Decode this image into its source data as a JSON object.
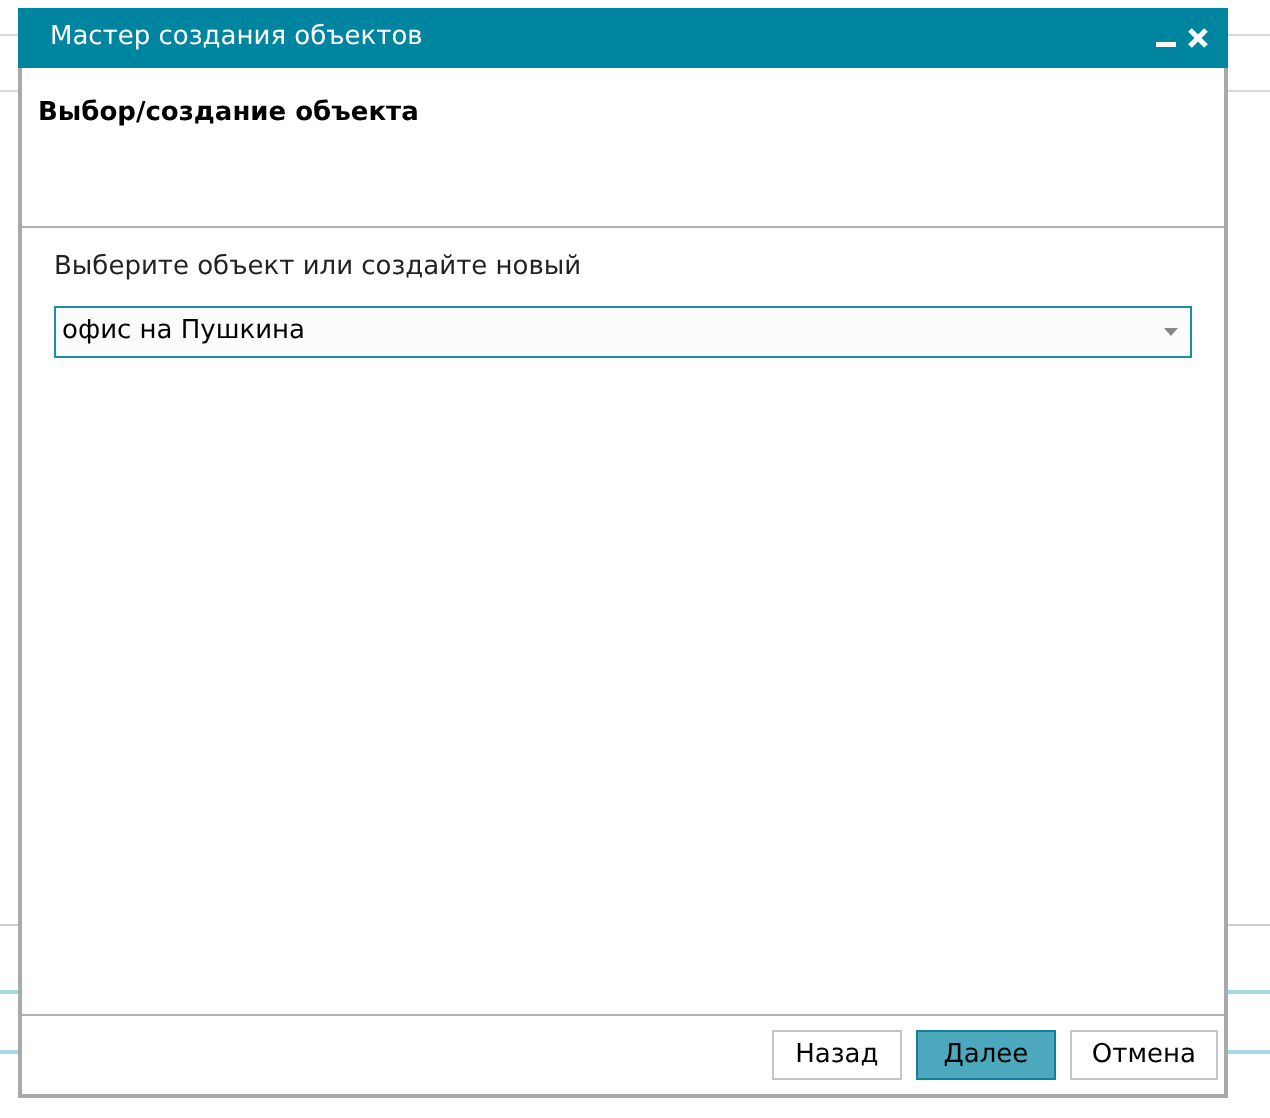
{
  "window": {
    "title": "Мастер создания объектов"
  },
  "header": {
    "title": "Выбор/создание объекта"
  },
  "prompt": "Выберите объект или создайте новый",
  "object_select": {
    "value": "офис на Пушкина"
  },
  "buttons": [
    {
      "label": "Назад",
      "primary": false
    },
    {
      "label": "Далее",
      "primary": true
    },
    {
      "label": "Отмена",
      "primary": false
    }
  ]
}
